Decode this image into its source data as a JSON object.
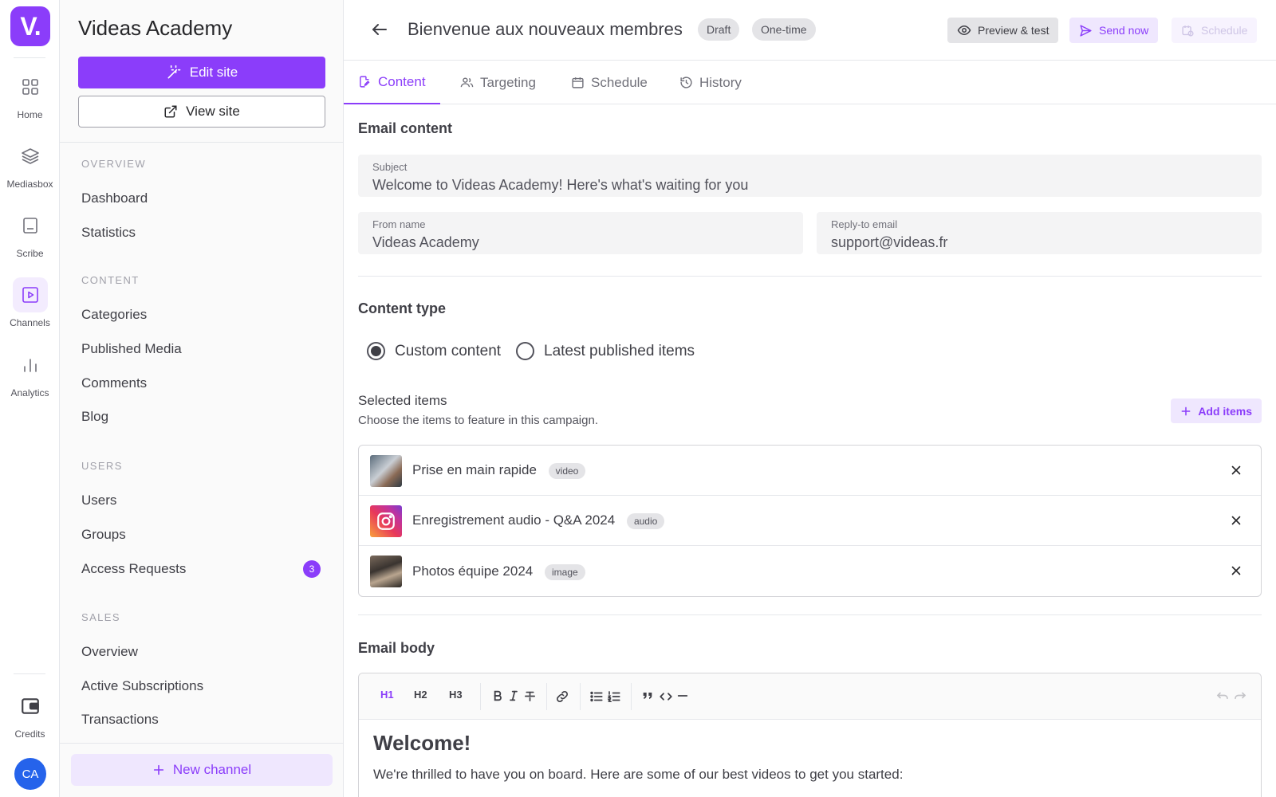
{
  "rail": {
    "logo": "V.",
    "items": [
      {
        "label": "Home",
        "icon": "grid-icon"
      },
      {
        "label": "Mediasbox",
        "icon": "layers-icon"
      },
      {
        "label": "Scribe",
        "icon": "document-icon"
      },
      {
        "label": "Channels",
        "icon": "play-icon"
      },
      {
        "label": "Analytics",
        "icon": "bar-chart-icon"
      }
    ],
    "credits_label": "Credits",
    "avatar_initials": "CA"
  },
  "sidebar": {
    "site_title": "Videas Academy",
    "edit_site": "Edit site",
    "view_site": "View site",
    "sections": {
      "overview": {
        "label": "OVERVIEW",
        "items": [
          "Dashboard",
          "Statistics"
        ]
      },
      "content": {
        "label": "CONTENT",
        "items": [
          "Categories",
          "Published Media",
          "Comments",
          "Blog"
        ]
      },
      "users": {
        "label": "USERS",
        "items": [
          "Users",
          "Groups",
          "Access Requests"
        ],
        "access_requests_count": "3"
      },
      "sales": {
        "label": "SALES",
        "items": [
          "Overview",
          "Active Subscriptions",
          "Transactions"
        ]
      }
    },
    "new_channel": "New channel"
  },
  "header": {
    "title": "Bienvenue aux nouveaux membres",
    "status": "Draft",
    "frequency": "One-time",
    "preview_btn": "Preview & test",
    "send_btn": "Send now",
    "schedule_btn": "Schedule"
  },
  "tabs": [
    "Content",
    "Targeting",
    "Schedule",
    "History"
  ],
  "email_content": {
    "heading": "Email content",
    "subject_label": "Subject",
    "subject_value": "Welcome to Videas Academy! Here's what's waiting for you",
    "from_label": "From name",
    "from_value": "Videas Academy",
    "reply_label": "Reply-to email",
    "reply_value": "support@videas.fr"
  },
  "content_type": {
    "heading": "Content type",
    "option_custom": "Custom content",
    "option_latest": "Latest published items",
    "selected": "Custom content"
  },
  "selected_items": {
    "heading": "Selected items",
    "subtitle": "Choose the items to feature in this campaign.",
    "add_btn": "Add items",
    "items": [
      {
        "title": "Prise en main rapide",
        "type": "video"
      },
      {
        "title": "Enregistrement audio - Q&A 2024",
        "type": "audio"
      },
      {
        "title": "Photos équipe 2024",
        "type": "image"
      }
    ]
  },
  "email_body": {
    "heading": "Email body",
    "toolbar": {
      "h1": "H1",
      "h2": "H2",
      "h3": "H3"
    },
    "h1_text": "Welcome!",
    "paragraph": "We're thrilled to have you on board. Here are some of our best videos to get you started:"
  },
  "colors": {
    "accent": "#8b3dfa",
    "accent_light": "#efe7fe",
    "avatar": "#2563eb"
  }
}
